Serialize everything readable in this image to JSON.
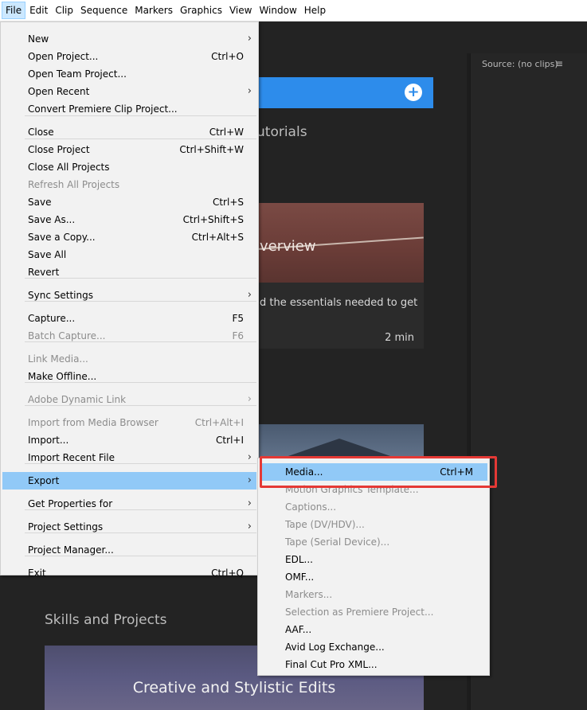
{
  "menubar": {
    "items": [
      "File",
      "Edit",
      "Clip",
      "Sequence",
      "Markers",
      "Graphics",
      "View",
      "Window",
      "Help"
    ]
  },
  "source_panel": {
    "title": "Source: (no clips)",
    "menu_icon": "hamburger-icon"
  },
  "home": {
    "tutorials_partial": "utorials",
    "card1": {
      "title_partial": "verview",
      "desc_partial": "d the essentials needed to get",
      "duration": "2 min"
    },
    "skills_title": "Skills and Projects",
    "card3": {
      "title": "Creative and Stylistic Edits"
    }
  },
  "file_menu": {
    "items": [
      {
        "label": "New",
        "shortcut": "",
        "submenu": true,
        "disabled": false
      },
      {
        "label": "Open Project...",
        "shortcut": "Ctrl+O",
        "submenu": false,
        "disabled": false
      },
      {
        "label": "Open Team Project...",
        "shortcut": "",
        "submenu": false,
        "disabled": false
      },
      {
        "label": "Open Recent",
        "shortcut": "",
        "submenu": true,
        "disabled": false
      },
      {
        "label": "Convert Premiere Clip Project...",
        "shortcut": "",
        "submenu": false,
        "disabled": false
      },
      {
        "label": "Close",
        "shortcut": "Ctrl+W",
        "submenu": false,
        "disabled": false
      },
      {
        "label": "Close Project",
        "shortcut": "Ctrl+Shift+W",
        "submenu": false,
        "disabled": false
      },
      {
        "label": "Close All Projects",
        "shortcut": "",
        "submenu": false,
        "disabled": false
      },
      {
        "label": "Refresh All Projects",
        "shortcut": "",
        "submenu": false,
        "disabled": true
      },
      {
        "label": "Save",
        "shortcut": "Ctrl+S",
        "submenu": false,
        "disabled": false
      },
      {
        "label": "Save As...",
        "shortcut": "Ctrl+Shift+S",
        "submenu": false,
        "disabled": false
      },
      {
        "label": "Save a Copy...",
        "shortcut": "Ctrl+Alt+S",
        "submenu": false,
        "disabled": false
      },
      {
        "label": "Save All",
        "shortcut": "",
        "submenu": false,
        "disabled": false
      },
      {
        "label": "Revert",
        "shortcut": "",
        "submenu": false,
        "disabled": false
      },
      {
        "label": "Sync Settings",
        "shortcut": "",
        "submenu": true,
        "disabled": false
      },
      {
        "label": "Capture...",
        "shortcut": "F5",
        "submenu": false,
        "disabled": false
      },
      {
        "label": "Batch Capture...",
        "shortcut": "F6",
        "submenu": false,
        "disabled": true
      },
      {
        "label": "Link Media...",
        "shortcut": "",
        "submenu": false,
        "disabled": true
      },
      {
        "label": "Make Offline...",
        "shortcut": "",
        "submenu": false,
        "disabled": false
      },
      {
        "label": "Adobe Dynamic Link",
        "shortcut": "",
        "submenu": true,
        "disabled": true
      },
      {
        "label": "Import from Media Browser",
        "shortcut": "Ctrl+Alt+I",
        "submenu": false,
        "disabled": true
      },
      {
        "label": "Import...",
        "shortcut": "Ctrl+I",
        "submenu": false,
        "disabled": false
      },
      {
        "label": "Import Recent File",
        "shortcut": "",
        "submenu": true,
        "disabled": false
      },
      {
        "label": "Export",
        "shortcut": "",
        "submenu": true,
        "disabled": false
      },
      {
        "label": "Get Properties for",
        "shortcut": "",
        "submenu": true,
        "disabled": false
      },
      {
        "label": "Project Settings",
        "shortcut": "",
        "submenu": true,
        "disabled": false
      },
      {
        "label": "Project Manager...",
        "shortcut": "",
        "submenu": false,
        "disabled": false
      },
      {
        "label": "Exit",
        "shortcut": "Ctrl+Q",
        "submenu": false,
        "disabled": false
      }
    ]
  },
  "export_menu": {
    "items": [
      {
        "label": "Media...",
        "shortcut": "Ctrl+M",
        "disabled": false
      },
      {
        "label": "Motion Graphics Template...",
        "shortcut": "",
        "disabled": true
      },
      {
        "label": "Captions...",
        "shortcut": "",
        "disabled": true
      },
      {
        "label": "Tape (DV/HDV)...",
        "shortcut": "",
        "disabled": true
      },
      {
        "label": "Tape (Serial Device)...",
        "shortcut": "",
        "disabled": true
      },
      {
        "label": "EDL...",
        "shortcut": "",
        "disabled": false
      },
      {
        "label": "OMF...",
        "shortcut": "",
        "disabled": false
      },
      {
        "label": "Markers...",
        "shortcut": "",
        "disabled": true
      },
      {
        "label": "Selection as Premiere Project...",
        "shortcut": "",
        "disabled": true
      },
      {
        "label": "AAF...",
        "shortcut": "",
        "disabled": false
      },
      {
        "label": "Avid Log Exchange...",
        "shortcut": "",
        "disabled": false
      },
      {
        "label": "Final Cut Pro XML...",
        "shortcut": "",
        "disabled": false
      }
    ]
  },
  "colors": {
    "highlight": "#91c9f7",
    "accent_blue": "#2d8ceb",
    "callout_red": "#e53935"
  }
}
